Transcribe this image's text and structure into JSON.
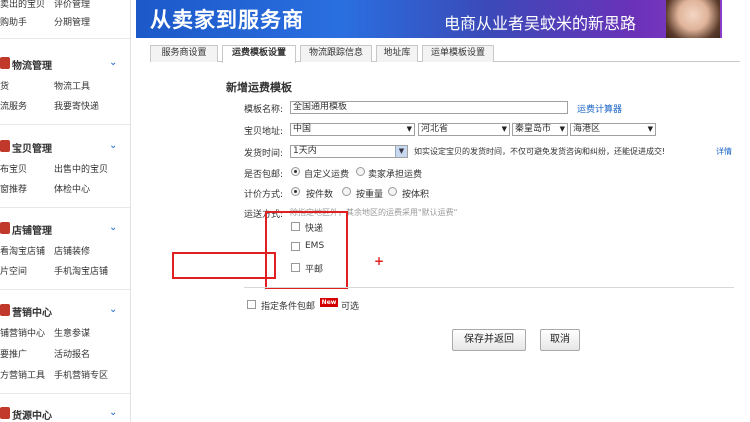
{
  "sidebar": {
    "top_links": [
      "卖出的宝贝",
      "评价管理",
      "购助手",
      "分期管理"
    ],
    "sections": [
      {
        "title": "物流管理",
        "links": [
          "货",
          "物流工具",
          "流服务",
          "我要寄快递"
        ]
      },
      {
        "title": "宝贝管理",
        "links": [
          "布宝贝",
          "出售中的宝贝",
          "窗推荐",
          "体检中心"
        ]
      },
      {
        "title": "店铺管理",
        "links": [
          "看淘宝店铺",
          "店铺装修",
          "片空间",
          "手机淘宝店铺"
        ]
      },
      {
        "title": "营销中心",
        "links": [
          "铺营销中心",
          "生意参谋",
          "要推广",
          "活动报名",
          "方营销工具",
          "手机营销专区"
        ]
      },
      {
        "title": "货源中心",
        "links": []
      }
    ]
  },
  "banner": {
    "headline": "从卖家到服务商",
    "subline": "电商从业者吴蚊米的新思路"
  },
  "tabs": [
    "服务商设置",
    "运费模板设置",
    "物流跟踪信息",
    "地址库",
    "运单模板设置"
  ],
  "active_tab": 1,
  "form": {
    "title": "新增运费模板",
    "name_label": "模板名称:",
    "name_value": "全国通用模板",
    "calc_link": "运费计算器",
    "address_label": "宝贝地址:",
    "country": "中国",
    "province": "河北省",
    "city": "秦皇岛市",
    "district": "海港区",
    "ship_time_label": "发货时间:",
    "ship_time_value": "1天内",
    "ship_time_note": "如实设定宝贝的发货时间，不仅可避免发货咨询和纠纷，还能促进成交!",
    "detail_link": "详情",
    "free_label": "是否包邮:",
    "free_options": [
      "自定义运费",
      "卖家承担运费"
    ],
    "price_label": "计价方式:",
    "price_options": [
      "按件数",
      "按重量",
      "按体积"
    ],
    "delivery_label": "运送方式:",
    "delivery_note": "除指定地区外，其余地区的运费采用\"默认运费\"",
    "delivery_options": [
      "快递",
      "EMS",
      "平邮"
    ],
    "plus": "+",
    "cond_label": "指定条件包邮",
    "new_badge": "New",
    "optional": "可选",
    "save_btn": "保存并返回",
    "cancel_btn": "取消"
  },
  "colors": {
    "link": "#1a64c8",
    "highlight": "#e02020",
    "badge": "#d40000"
  }
}
